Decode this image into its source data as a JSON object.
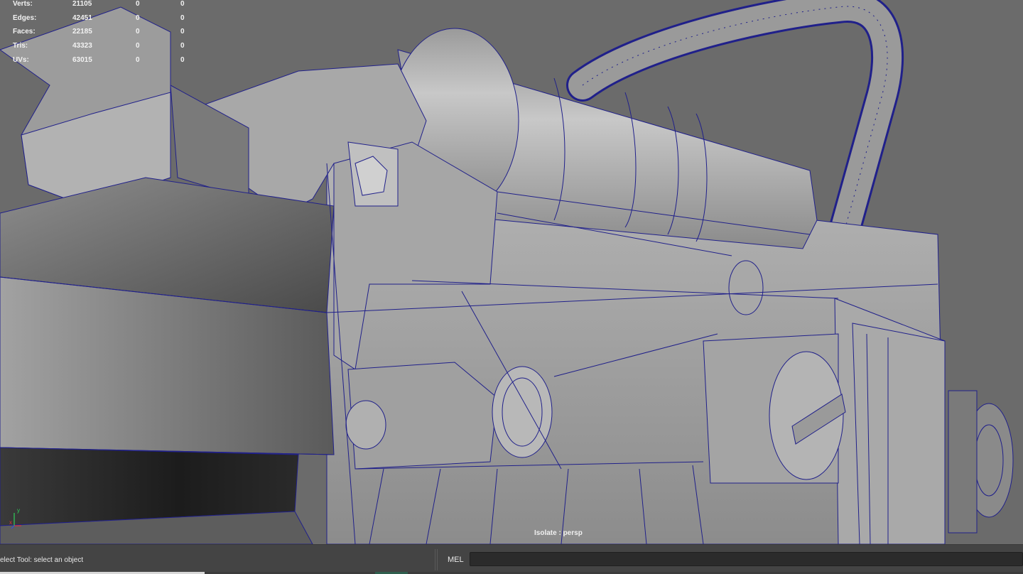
{
  "hud": {
    "rows": [
      {
        "label": "Verts:",
        "total": "21105",
        "selected": "0",
        "components": "0"
      },
      {
        "label": "Edges:",
        "total": "42451",
        "selected": "0",
        "components": "0"
      },
      {
        "label": "Faces:",
        "total": "22185",
        "selected": "0",
        "components": "0"
      },
      {
        "label": "Tris:",
        "total": "43323",
        "selected": "0",
        "components": "0"
      },
      {
        "label": "UVs:",
        "total": "63015",
        "selected": "0",
        "components": "0"
      }
    ]
  },
  "viewport": {
    "camera_label": "Isolate : persp",
    "axis": {
      "y": "y",
      "x": "x"
    },
    "colors": {
      "background": "#6b6b6b",
      "wire": "#20208a",
      "axis_x": "#e0303a",
      "axis_y": "#2fd05a"
    }
  },
  "statusbar": {
    "help_text": "elect Tool: select an object",
    "mel_label": "MEL",
    "mel_value": "",
    "progress": 0.2
  }
}
